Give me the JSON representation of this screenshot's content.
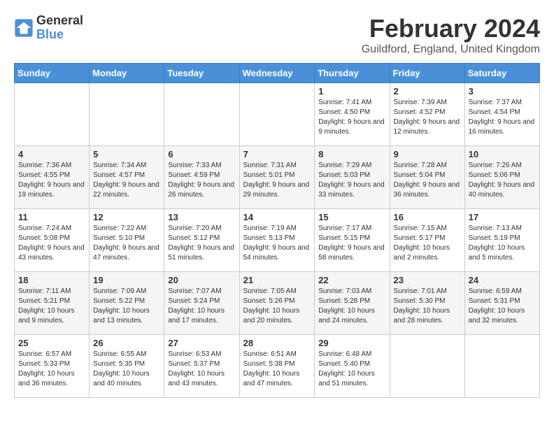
{
  "header": {
    "logo_line1": "General",
    "logo_line2": "Blue",
    "month_year": "February 2024",
    "location": "Guildford, England, United Kingdom"
  },
  "weekdays": [
    "Sunday",
    "Monday",
    "Tuesday",
    "Wednesday",
    "Thursday",
    "Friday",
    "Saturday"
  ],
  "weeks": [
    [
      {
        "day": "",
        "info": ""
      },
      {
        "day": "",
        "info": ""
      },
      {
        "day": "",
        "info": ""
      },
      {
        "day": "",
        "info": ""
      },
      {
        "day": "1",
        "info": "Sunrise: 7:41 AM\nSunset: 4:50 PM\nDaylight: 9 hours and 9 minutes."
      },
      {
        "day": "2",
        "info": "Sunrise: 7:39 AM\nSunset: 4:52 PM\nDaylight: 9 hours and 12 minutes."
      },
      {
        "day": "3",
        "info": "Sunrise: 7:37 AM\nSunset: 4:54 PM\nDaylight: 9 hours and 16 minutes."
      }
    ],
    [
      {
        "day": "4",
        "info": "Sunrise: 7:36 AM\nSunset: 4:55 PM\nDaylight: 9 hours and 19 minutes."
      },
      {
        "day": "5",
        "info": "Sunrise: 7:34 AM\nSunset: 4:57 PM\nDaylight: 9 hours and 22 minutes."
      },
      {
        "day": "6",
        "info": "Sunrise: 7:33 AM\nSunset: 4:59 PM\nDaylight: 9 hours and 26 minutes."
      },
      {
        "day": "7",
        "info": "Sunrise: 7:31 AM\nSunset: 5:01 PM\nDaylight: 9 hours and 29 minutes."
      },
      {
        "day": "8",
        "info": "Sunrise: 7:29 AM\nSunset: 5:03 PM\nDaylight: 9 hours and 33 minutes."
      },
      {
        "day": "9",
        "info": "Sunrise: 7:28 AM\nSunset: 5:04 PM\nDaylight: 9 hours and 36 minutes."
      },
      {
        "day": "10",
        "info": "Sunrise: 7:26 AM\nSunset: 5:06 PM\nDaylight: 9 hours and 40 minutes."
      }
    ],
    [
      {
        "day": "11",
        "info": "Sunrise: 7:24 AM\nSunset: 5:08 PM\nDaylight: 9 hours and 43 minutes."
      },
      {
        "day": "12",
        "info": "Sunrise: 7:22 AM\nSunset: 5:10 PM\nDaylight: 9 hours and 47 minutes."
      },
      {
        "day": "13",
        "info": "Sunrise: 7:20 AM\nSunset: 5:12 PM\nDaylight: 9 hours and 51 minutes."
      },
      {
        "day": "14",
        "info": "Sunrise: 7:19 AM\nSunset: 5:13 PM\nDaylight: 9 hours and 54 minutes."
      },
      {
        "day": "15",
        "info": "Sunrise: 7:17 AM\nSunset: 5:15 PM\nDaylight: 9 hours and 58 minutes."
      },
      {
        "day": "16",
        "info": "Sunrise: 7:15 AM\nSunset: 5:17 PM\nDaylight: 10 hours and 2 minutes."
      },
      {
        "day": "17",
        "info": "Sunrise: 7:13 AM\nSunset: 5:19 PM\nDaylight: 10 hours and 5 minutes."
      }
    ],
    [
      {
        "day": "18",
        "info": "Sunrise: 7:11 AM\nSunset: 5:21 PM\nDaylight: 10 hours and 9 minutes."
      },
      {
        "day": "19",
        "info": "Sunrise: 7:09 AM\nSunset: 5:22 PM\nDaylight: 10 hours and 13 minutes."
      },
      {
        "day": "20",
        "info": "Sunrise: 7:07 AM\nSunset: 5:24 PM\nDaylight: 10 hours and 17 minutes."
      },
      {
        "day": "21",
        "info": "Sunrise: 7:05 AM\nSunset: 5:26 PM\nDaylight: 10 hours and 20 minutes."
      },
      {
        "day": "22",
        "info": "Sunrise: 7:03 AM\nSunset: 5:28 PM\nDaylight: 10 hours and 24 minutes."
      },
      {
        "day": "23",
        "info": "Sunrise: 7:01 AM\nSunset: 5:30 PM\nDaylight: 10 hours and 28 minutes."
      },
      {
        "day": "24",
        "info": "Sunrise: 6:59 AM\nSunset: 5:31 PM\nDaylight: 10 hours and 32 minutes."
      }
    ],
    [
      {
        "day": "25",
        "info": "Sunrise: 6:57 AM\nSunset: 5:33 PM\nDaylight: 10 hours and 36 minutes."
      },
      {
        "day": "26",
        "info": "Sunrise: 6:55 AM\nSunset: 5:35 PM\nDaylight: 10 hours and 40 minutes."
      },
      {
        "day": "27",
        "info": "Sunrise: 6:53 AM\nSunset: 5:37 PM\nDaylight: 10 hours and 43 minutes."
      },
      {
        "day": "28",
        "info": "Sunrise: 6:51 AM\nSunset: 5:38 PM\nDaylight: 10 hours and 47 minutes."
      },
      {
        "day": "29",
        "info": "Sunrise: 6:48 AM\nSunset: 5:40 PM\nDaylight: 10 hours and 51 minutes."
      },
      {
        "day": "",
        "info": ""
      },
      {
        "day": "",
        "info": ""
      }
    ]
  ]
}
